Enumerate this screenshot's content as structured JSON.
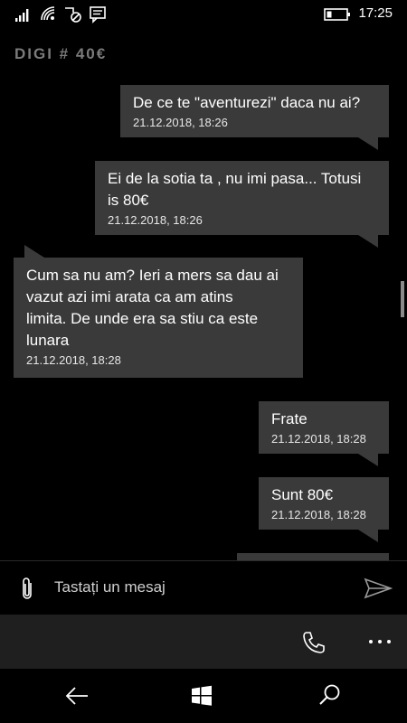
{
  "status_bar": {
    "time": "17:25",
    "icons": [
      "signal-icon",
      "wifi-icon",
      "blocked-icon",
      "message-notification-icon",
      "battery-icon"
    ]
  },
  "conversation": {
    "contact_name": "DIGI # 40€"
  },
  "messages": [
    {
      "direction": "outgoing",
      "text": "De ce te \"aventurezi\" daca nu ai?",
      "timestamp": "21.12.2018, 18:26"
    },
    {
      "direction": "outgoing",
      "text": "Ei de la sotia ta , nu imi pasa... Totusi\nis 80€",
      "timestamp": "21.12.2018, 18:26"
    },
    {
      "direction": "incoming",
      "text": "Cum sa nu am? Ieri a mers sa dau ai\nvazut azi imi arata ca am atins\nlimita. De unde era sa stiu ca este\nlunara",
      "timestamp": "21.12.2018, 18:28"
    },
    {
      "direction": "outgoing",
      "text": "Frate",
      "timestamp": "21.12.2018, 18:28"
    },
    {
      "direction": "outgoing",
      "text": "Sunt 80€",
      "timestamp": "21.12.2018, 18:28"
    }
  ],
  "composer": {
    "placeholder": "Tastați un mesaj"
  },
  "app_bar": {
    "icons": [
      "phone-icon",
      "more-icon"
    ]
  },
  "nav_bar": {
    "icons": [
      "back-icon",
      "windows-icon",
      "search-icon"
    ]
  },
  "colors": {
    "background": "#000000",
    "bubble": "#3a3a3a",
    "app_bar": "#1f1f1f",
    "title": "#7b7b7b"
  }
}
